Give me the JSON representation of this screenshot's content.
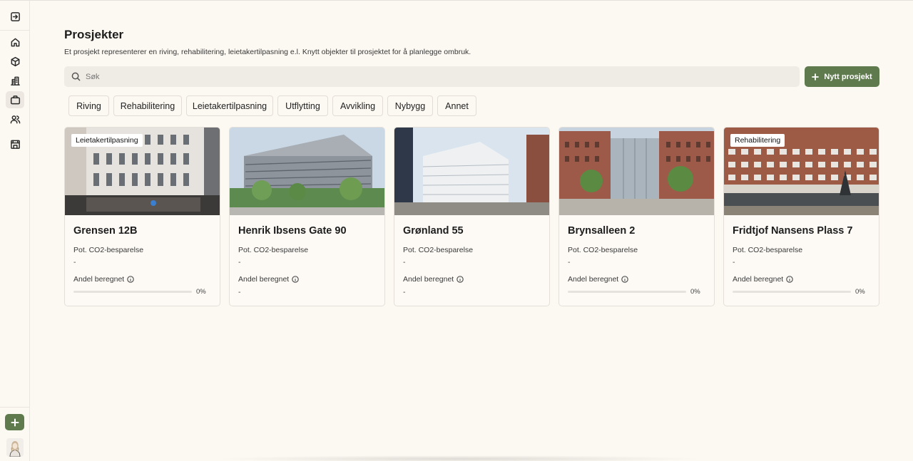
{
  "sidebar": {
    "items": [
      {
        "name": "collapse-icon"
      },
      {
        "name": "home-icon"
      },
      {
        "name": "box-icon"
      },
      {
        "name": "buildings-icon"
      },
      {
        "name": "briefcase-icon"
      },
      {
        "name": "users-icon"
      },
      {
        "name": "store-icon"
      }
    ],
    "active": "briefcase-icon",
    "add_icon": "plus-icon"
  },
  "page": {
    "title": "Prosjekter",
    "subtitle": "Et prosjekt representerer en riving, rehabilitering, leietakertilpasning e.l. Knytt objekter til prosjektet for å planlegge ombruk."
  },
  "search": {
    "placeholder": "Søk",
    "value": ""
  },
  "new_project_label": "Nytt prosjekt",
  "filters": [
    "Riving",
    "Rehabilitering",
    "Leietakertilpasning",
    "Utflytting",
    "Avvikling",
    "Nybygg",
    "Annet"
  ],
  "labels": {
    "co2": "Pot. CO2-besparelse",
    "andel": "Andel beregnet"
  },
  "projects": [
    {
      "title": "Grensen 12B",
      "badge": "Leietakertilpasning",
      "co2": "-",
      "andel_value": "0%",
      "andel_fraction": 0
    },
    {
      "title": "Henrik Ibsens Gate 90",
      "badge": "",
      "co2": "-",
      "andel_value": "-",
      "andel_fraction": null
    },
    {
      "title": "Grønland 55",
      "badge": "",
      "co2": "-",
      "andel_value": "-",
      "andel_fraction": null
    },
    {
      "title": "Brynsalleen 2",
      "badge": "",
      "co2": "-",
      "andel_value": "0%",
      "andel_fraction": 0
    },
    {
      "title": "Fridtjof Nansens Plass 7",
      "badge": "Rehabilitering",
      "co2": "-",
      "andel_value": "0%",
      "andel_fraction": 0
    }
  ],
  "colors": {
    "accent": "#5f7a4d",
    "background": "#fcf8f2",
    "search_bg": "#efebe5"
  }
}
